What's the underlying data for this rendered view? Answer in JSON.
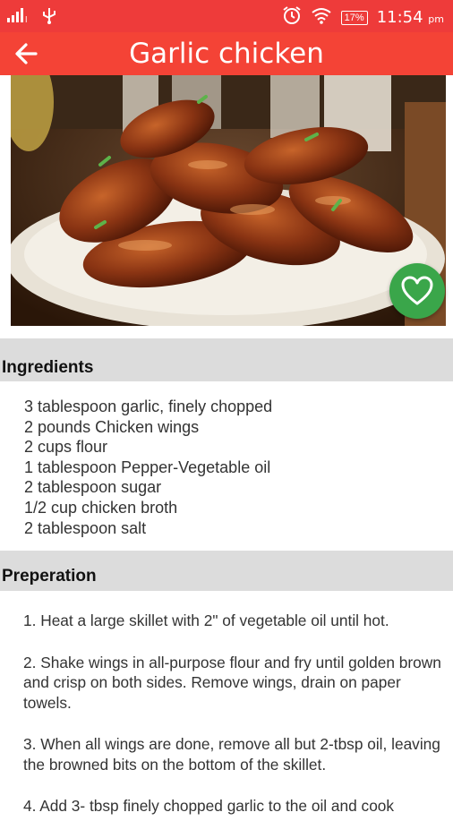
{
  "status_bar": {
    "time": "11:54",
    "ampm": "pm",
    "battery": "17%",
    "icons": [
      "signal-icon",
      "usb-icon",
      "alarm-icon",
      "wifi-icon",
      "battery-icon"
    ]
  },
  "toolbar": {
    "title": "Garlic chicken",
    "back_icon": "arrow-left-icon",
    "color": "#f44336"
  },
  "hero": {
    "image": "glazed-chicken-wings-photo",
    "favorite_icon": "heart-icon",
    "favorite_color": "#3aa64a"
  },
  "ingredients": {
    "heading": "Ingredients",
    "items": [
      "3 tablespoon garlic, finely chopped",
      "2 pounds Chicken wings",
      "2 cups flour",
      "1 tablespoon Pepper-Vegetable oil",
      "2 tablespoon sugar",
      "1/2 cup chicken broth",
      "2 tablespoon salt"
    ]
  },
  "preparation": {
    "heading": "Preperation",
    "steps": [
      "1. Heat a large skillet with 2\" of vegetable oil until hot.",
      "2. Shake wings in all-purpose flour and fry until golden brown and crisp on both sides. Remove wings, drain on paper towels.",
      "3. When all wings are done, remove all but 2-tbsp oil, leaving the browned bits on the bottom of the skillet.",
      "4. Add 3- tbsp finely chopped garlic to the oil and cook"
    ]
  }
}
